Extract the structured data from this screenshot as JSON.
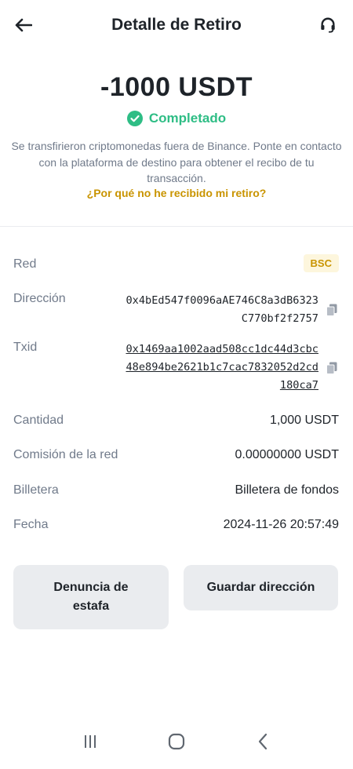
{
  "header": {
    "title": "Detalle de Retiro"
  },
  "summary": {
    "amount": "-1000 USDT",
    "status": "Completado",
    "description": "Se transfirieron criptomonedas fuera de Binance. Ponte en contacto con la plataforma de destino para obtener el recibo de tu transacción.",
    "help_link": "¿Por qué no he recibido mi retiro?"
  },
  "details": {
    "network": {
      "label": "Red",
      "value": "BSC"
    },
    "address": {
      "label": "Dirección",
      "value": "0x4bEd547f0096aAE746C8a3dB6323C770bf2f2757"
    },
    "txid": {
      "label": "Txid",
      "value": "0x1469aa1002aad508cc1dc44d3cbc48e894be2621b1c7cac7832052d2cd180ca7"
    },
    "amount": {
      "label": "Cantidad",
      "value": "1,000 USDT"
    },
    "fee": {
      "label": "Comisión de la red",
      "value": "0.00000000 USDT"
    },
    "wallet": {
      "label": "Billetera",
      "value": "Billetera de fondos"
    },
    "date": {
      "label": "Fecha",
      "value": "2024-11-26 20:57:49"
    }
  },
  "actions": {
    "report_scam": "Denuncia de estafa",
    "save_address": "Guardar dirección"
  },
  "colors": {
    "success": "#2ebd85",
    "brand_gold": "#c99400",
    "muted_text": "#707a8a",
    "button_bg": "#eaecef"
  },
  "icons": {
    "back": "arrow-left-icon",
    "support": "headset-icon",
    "status": "check-circle-icon",
    "copy": "copy-icon",
    "nav_recent": "recent-apps-icon",
    "nav_home": "home-icon",
    "nav_back": "chevron-left-icon"
  }
}
